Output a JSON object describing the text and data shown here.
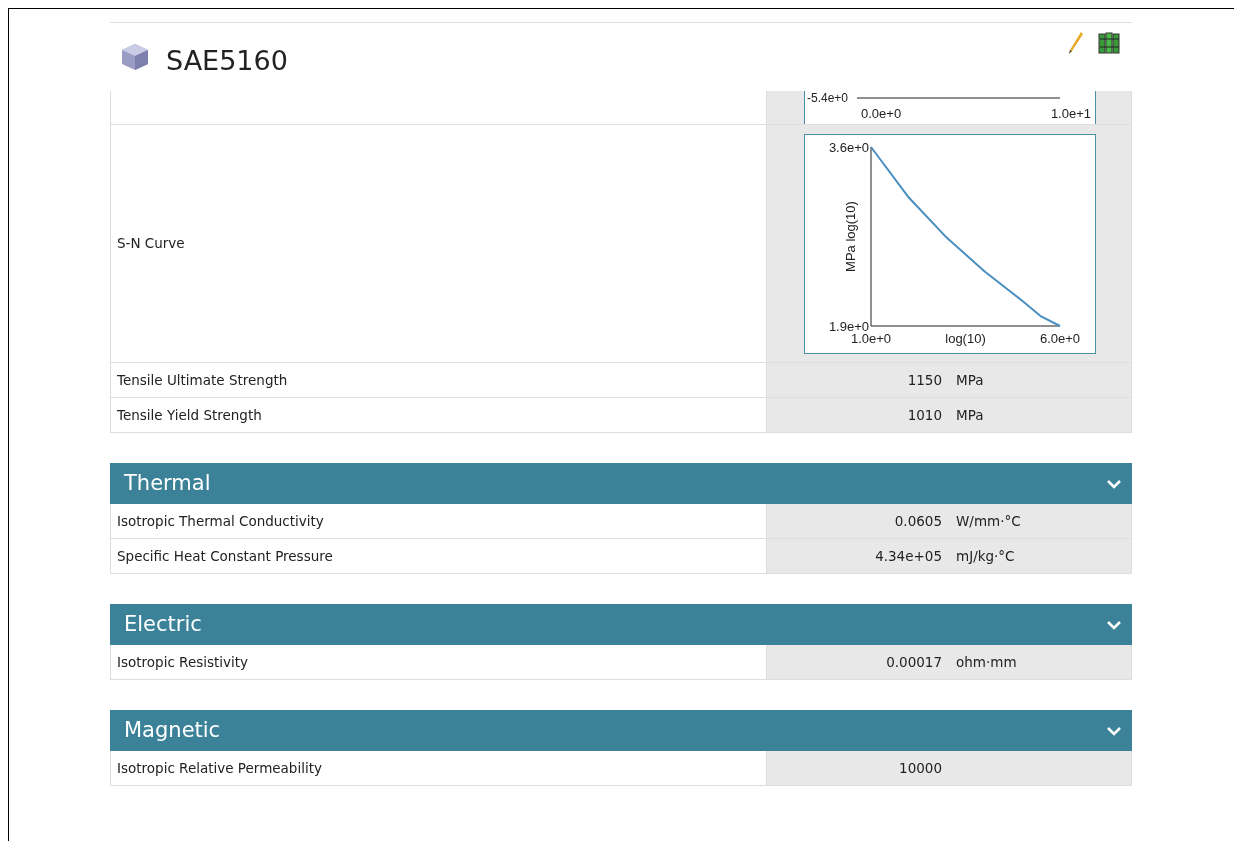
{
  "title": "SAE5160",
  "top_rows": [
    {
      "kind": "chart_partial",
      "ticks": [
        "-5.4e+0",
        "0.0e+0",
        "1.0e+1"
      ]
    },
    {
      "kind": "chart",
      "label": "S-N Curve",
      "chart_data": {
        "type": "line",
        "xlabel": "log(10)",
        "ylabel": "MPa log(10)",
        "x": [
          1,
          2,
          3,
          4,
          5,
          5.5,
          6
        ],
        "series": [
          {
            "color": "#4a8fc0",
            "values": [
              3.6,
              3.12,
              2.74,
              2.42,
              2.14,
              1.99,
              1.9
            ]
          }
        ],
        "xlim": [
          1,
          6
        ],
        "ylim": [
          1.9,
          3.6
        ],
        "xticks": [
          {
            "value": 1,
            "label": "1.0e+0"
          },
          {
            "value": 6,
            "label": "6.0e+0"
          }
        ],
        "yticks": [
          {
            "value": 1.9,
            "label": "1.9e+0"
          },
          {
            "value": 3.6,
            "label": "3.6e+0"
          }
        ]
      }
    },
    {
      "kind": "value",
      "label": "Tensile Ultimate Strength",
      "value": "1150",
      "unit": "MPa"
    },
    {
      "kind": "value",
      "label": "Tensile Yield Strength",
      "value": "1010",
      "unit": "MPa"
    }
  ],
  "sections": [
    {
      "title": "Thermal",
      "expanded": true,
      "rows": [
        {
          "kind": "value",
          "label": "Isotropic Thermal Conductivity",
          "value": "0.0605",
          "unit": "W/mm·°C"
        },
        {
          "kind": "value",
          "label": "Specific Heat Constant Pressure",
          "value": "4.34e+05",
          "unit": "mJ/kg·°C"
        }
      ]
    },
    {
      "title": "Electric",
      "expanded": true,
      "rows": [
        {
          "kind": "value",
          "label": "Isotropic Resistivity",
          "value": "0.00017",
          "unit": "ohm·mm"
        }
      ]
    },
    {
      "title": "Magnetic",
      "expanded": true,
      "rows": [
        {
          "kind": "value",
          "label": "Isotropic Relative Permeability",
          "value": "10000"
        }
      ]
    }
  ]
}
